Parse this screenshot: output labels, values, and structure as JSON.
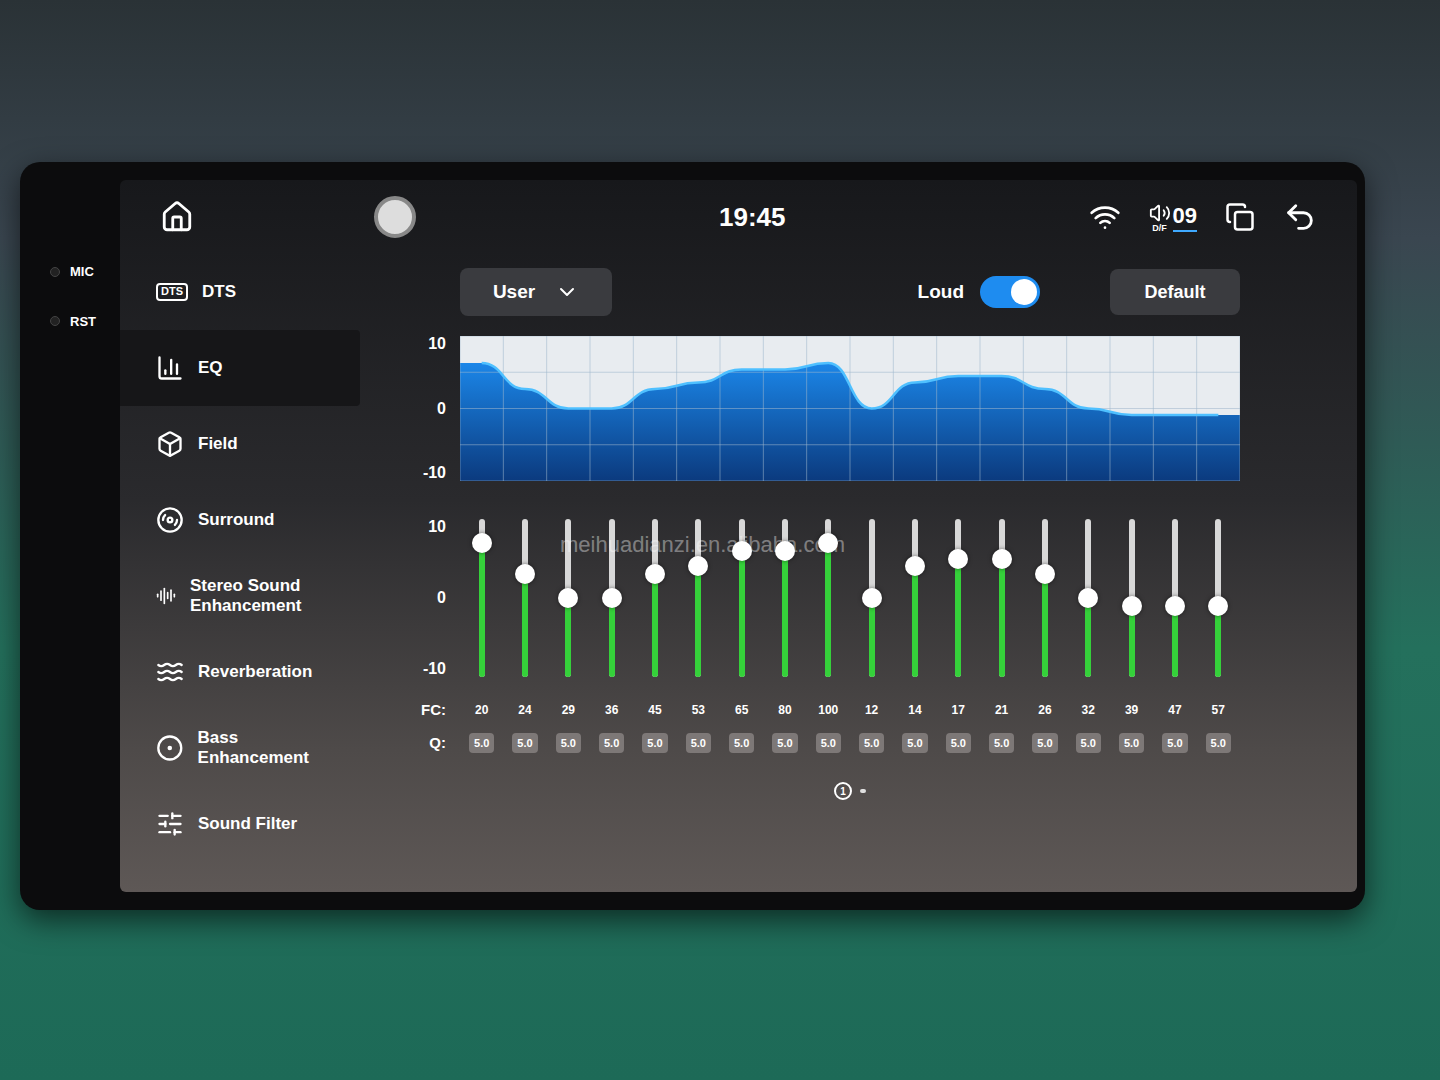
{
  "bezel": {
    "labels": [
      "MIC",
      "RST"
    ]
  },
  "status_bar": {
    "time": "19:45",
    "volume": "09",
    "volume_badge": "D/F"
  },
  "sidebar": {
    "items": [
      {
        "label": "DTS",
        "icon_text": "DTS",
        "selected": false
      },
      {
        "label": "EQ",
        "selected": true
      },
      {
        "label": "Field",
        "selected": false
      },
      {
        "label": "Surround",
        "selected": false
      },
      {
        "label": "Stereo Sound Enhancement",
        "selected": false
      },
      {
        "label": "Reverberation",
        "selected": false
      },
      {
        "label": "Bass Enhancement",
        "selected": false
      },
      {
        "label": "Sound Filter",
        "selected": false
      }
    ]
  },
  "preset": {
    "value": "User"
  },
  "loud": {
    "label": "Loud",
    "on": true
  },
  "default_button": "Default",
  "chart": {
    "ticks": [
      "10",
      "0",
      "-10"
    ],
    "series": [
      {
        "values": [
          7,
          3,
          0,
          0,
          3,
          4,
          6,
          6,
          7,
          0,
          4,
          5,
          5,
          3,
          0,
          -1,
          -1,
          -1
        ]
      }
    ]
  },
  "sliders": {
    "ticks": [
      "10",
      "0",
      "-10"
    ],
    "fc_label": "FC:",
    "q_label": "Q:",
    "bands": [
      {
        "fc": "20",
        "q": "5.0",
        "level": 0.85
      },
      {
        "fc": "24",
        "q": "5.0",
        "level": 0.65
      },
      {
        "fc": "29",
        "q": "5.0",
        "level": 0.5
      },
      {
        "fc": "36",
        "q": "5.0",
        "level": 0.5
      },
      {
        "fc": "45",
        "q": "5.0",
        "level": 0.65
      },
      {
        "fc": "53",
        "q": "5.0",
        "level": 0.7
      },
      {
        "fc": "65",
        "q": "5.0",
        "level": 0.8
      },
      {
        "fc": "80",
        "q": "5.0",
        "level": 0.8
      },
      {
        "fc": "100",
        "q": "5.0",
        "level": 0.85
      },
      {
        "fc": "12",
        "q": "5.0",
        "level": 0.5
      },
      {
        "fc": "14",
        "q": "5.0",
        "level": 0.7
      },
      {
        "fc": "17",
        "q": "5.0",
        "level": 0.75
      },
      {
        "fc": "21",
        "q": "5.0",
        "level": 0.75
      },
      {
        "fc": "26",
        "q": "5.0",
        "level": 0.65
      },
      {
        "fc": "32",
        "q": "5.0",
        "level": 0.5
      },
      {
        "fc": "39",
        "q": "5.0",
        "level": 0.45
      },
      {
        "fc": "47",
        "q": "5.0",
        "level": 0.45
      },
      {
        "fc": "57",
        "q": "5.0",
        "level": 0.45
      }
    ]
  },
  "pages": [
    {
      "label": "1",
      "selected": true
    },
    {
      "label": "",
      "selected": false
    }
  ],
  "watermark": "meihuadianzi.en.alibaba.com"
}
